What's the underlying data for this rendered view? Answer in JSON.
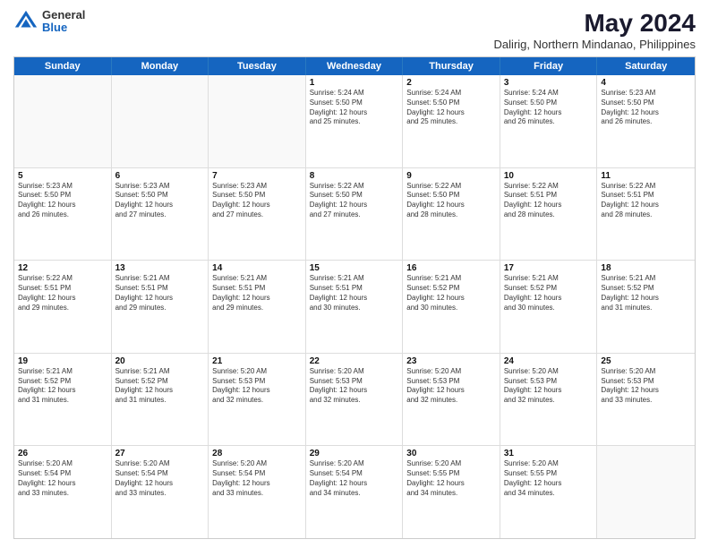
{
  "logo": {
    "general": "General",
    "blue": "Blue"
  },
  "title": "May 2024",
  "subtitle": "Dalirig, Northern Mindanao, Philippines",
  "days": [
    "Sunday",
    "Monday",
    "Tuesday",
    "Wednesday",
    "Thursday",
    "Friday",
    "Saturday"
  ],
  "weeks": [
    [
      {
        "day": "",
        "text": ""
      },
      {
        "day": "",
        "text": ""
      },
      {
        "day": "",
        "text": ""
      },
      {
        "day": "1",
        "text": "Sunrise: 5:24 AM\nSunset: 5:50 PM\nDaylight: 12 hours\nand 25 minutes."
      },
      {
        "day": "2",
        "text": "Sunrise: 5:24 AM\nSunset: 5:50 PM\nDaylight: 12 hours\nand 25 minutes."
      },
      {
        "day": "3",
        "text": "Sunrise: 5:24 AM\nSunset: 5:50 PM\nDaylight: 12 hours\nand 26 minutes."
      },
      {
        "day": "4",
        "text": "Sunrise: 5:23 AM\nSunset: 5:50 PM\nDaylight: 12 hours\nand 26 minutes."
      }
    ],
    [
      {
        "day": "5",
        "text": "Sunrise: 5:23 AM\nSunset: 5:50 PM\nDaylight: 12 hours\nand 26 minutes."
      },
      {
        "day": "6",
        "text": "Sunrise: 5:23 AM\nSunset: 5:50 PM\nDaylight: 12 hours\nand 27 minutes."
      },
      {
        "day": "7",
        "text": "Sunrise: 5:23 AM\nSunset: 5:50 PM\nDaylight: 12 hours\nand 27 minutes."
      },
      {
        "day": "8",
        "text": "Sunrise: 5:22 AM\nSunset: 5:50 PM\nDaylight: 12 hours\nand 27 minutes."
      },
      {
        "day": "9",
        "text": "Sunrise: 5:22 AM\nSunset: 5:50 PM\nDaylight: 12 hours\nand 28 minutes."
      },
      {
        "day": "10",
        "text": "Sunrise: 5:22 AM\nSunset: 5:51 PM\nDaylight: 12 hours\nand 28 minutes."
      },
      {
        "day": "11",
        "text": "Sunrise: 5:22 AM\nSunset: 5:51 PM\nDaylight: 12 hours\nand 28 minutes."
      }
    ],
    [
      {
        "day": "12",
        "text": "Sunrise: 5:22 AM\nSunset: 5:51 PM\nDaylight: 12 hours\nand 29 minutes."
      },
      {
        "day": "13",
        "text": "Sunrise: 5:21 AM\nSunset: 5:51 PM\nDaylight: 12 hours\nand 29 minutes."
      },
      {
        "day": "14",
        "text": "Sunrise: 5:21 AM\nSunset: 5:51 PM\nDaylight: 12 hours\nand 29 minutes."
      },
      {
        "day": "15",
        "text": "Sunrise: 5:21 AM\nSunset: 5:51 PM\nDaylight: 12 hours\nand 30 minutes."
      },
      {
        "day": "16",
        "text": "Sunrise: 5:21 AM\nSunset: 5:52 PM\nDaylight: 12 hours\nand 30 minutes."
      },
      {
        "day": "17",
        "text": "Sunrise: 5:21 AM\nSunset: 5:52 PM\nDaylight: 12 hours\nand 30 minutes."
      },
      {
        "day": "18",
        "text": "Sunrise: 5:21 AM\nSunset: 5:52 PM\nDaylight: 12 hours\nand 31 minutes."
      }
    ],
    [
      {
        "day": "19",
        "text": "Sunrise: 5:21 AM\nSunset: 5:52 PM\nDaylight: 12 hours\nand 31 minutes."
      },
      {
        "day": "20",
        "text": "Sunrise: 5:21 AM\nSunset: 5:52 PM\nDaylight: 12 hours\nand 31 minutes."
      },
      {
        "day": "21",
        "text": "Sunrise: 5:20 AM\nSunset: 5:53 PM\nDaylight: 12 hours\nand 32 minutes."
      },
      {
        "day": "22",
        "text": "Sunrise: 5:20 AM\nSunset: 5:53 PM\nDaylight: 12 hours\nand 32 minutes."
      },
      {
        "day": "23",
        "text": "Sunrise: 5:20 AM\nSunset: 5:53 PM\nDaylight: 12 hours\nand 32 minutes."
      },
      {
        "day": "24",
        "text": "Sunrise: 5:20 AM\nSunset: 5:53 PM\nDaylight: 12 hours\nand 32 minutes."
      },
      {
        "day": "25",
        "text": "Sunrise: 5:20 AM\nSunset: 5:53 PM\nDaylight: 12 hours\nand 33 minutes."
      }
    ],
    [
      {
        "day": "26",
        "text": "Sunrise: 5:20 AM\nSunset: 5:54 PM\nDaylight: 12 hours\nand 33 minutes."
      },
      {
        "day": "27",
        "text": "Sunrise: 5:20 AM\nSunset: 5:54 PM\nDaylight: 12 hours\nand 33 minutes."
      },
      {
        "day": "28",
        "text": "Sunrise: 5:20 AM\nSunset: 5:54 PM\nDaylight: 12 hours\nand 33 minutes."
      },
      {
        "day": "29",
        "text": "Sunrise: 5:20 AM\nSunset: 5:54 PM\nDaylight: 12 hours\nand 34 minutes."
      },
      {
        "day": "30",
        "text": "Sunrise: 5:20 AM\nSunset: 5:55 PM\nDaylight: 12 hours\nand 34 minutes."
      },
      {
        "day": "31",
        "text": "Sunrise: 5:20 AM\nSunset: 5:55 PM\nDaylight: 12 hours\nand 34 minutes."
      },
      {
        "day": "",
        "text": ""
      }
    ]
  ]
}
